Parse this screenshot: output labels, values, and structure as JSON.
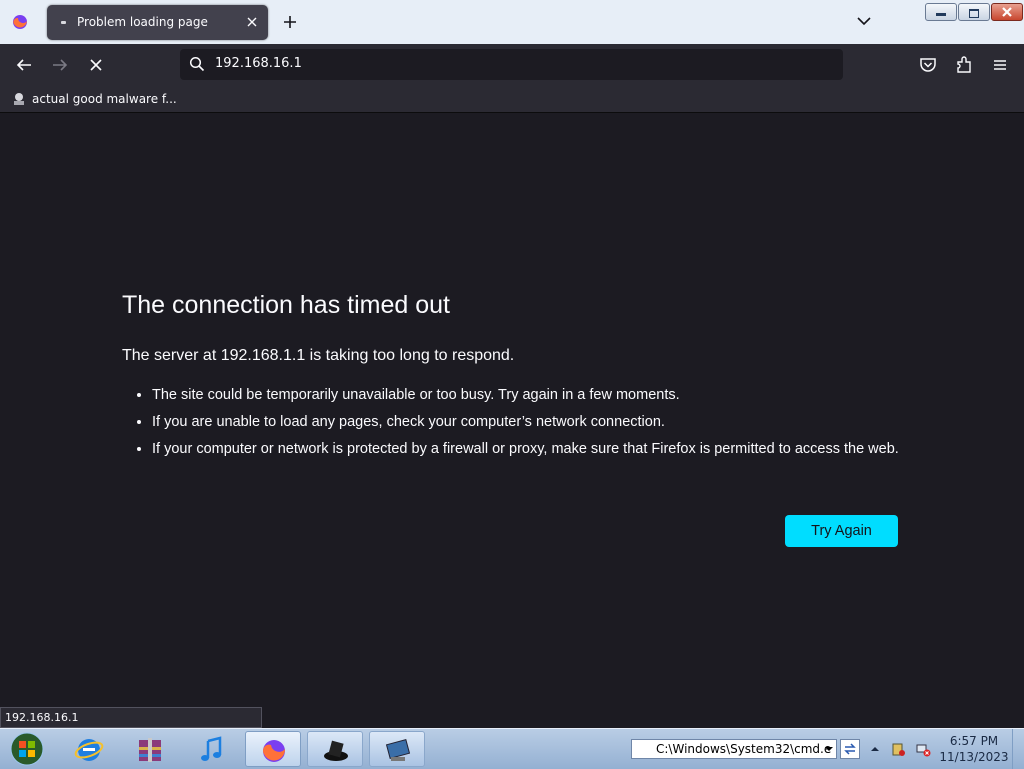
{
  "browser": {
    "tab_title": "Problem loading page",
    "url": "192.168.16.1",
    "bookmark_label": "actual good malware f..."
  },
  "error": {
    "title": "The connection has timed out",
    "subtitle": "The server at 192.168.1.1 is taking too long to respond.",
    "bullets": [
      "The site could be temporarily unavailable or too busy. Try again in a few moments.",
      "If you are unable to load any pages, check your computer’s network connection.",
      "If your computer or network is protected by a firewall or proxy, make sure that Firefox is permitted to access the web."
    ],
    "button": "Try Again",
    "accent_color": "#00ddff"
  },
  "status_text": "192.168.16.1",
  "taskbar": {
    "address_value": "C:\\Windows\\System32\\cmd.e",
    "clock_time": "6:57 PM",
    "clock_date": "11/13/2023"
  }
}
